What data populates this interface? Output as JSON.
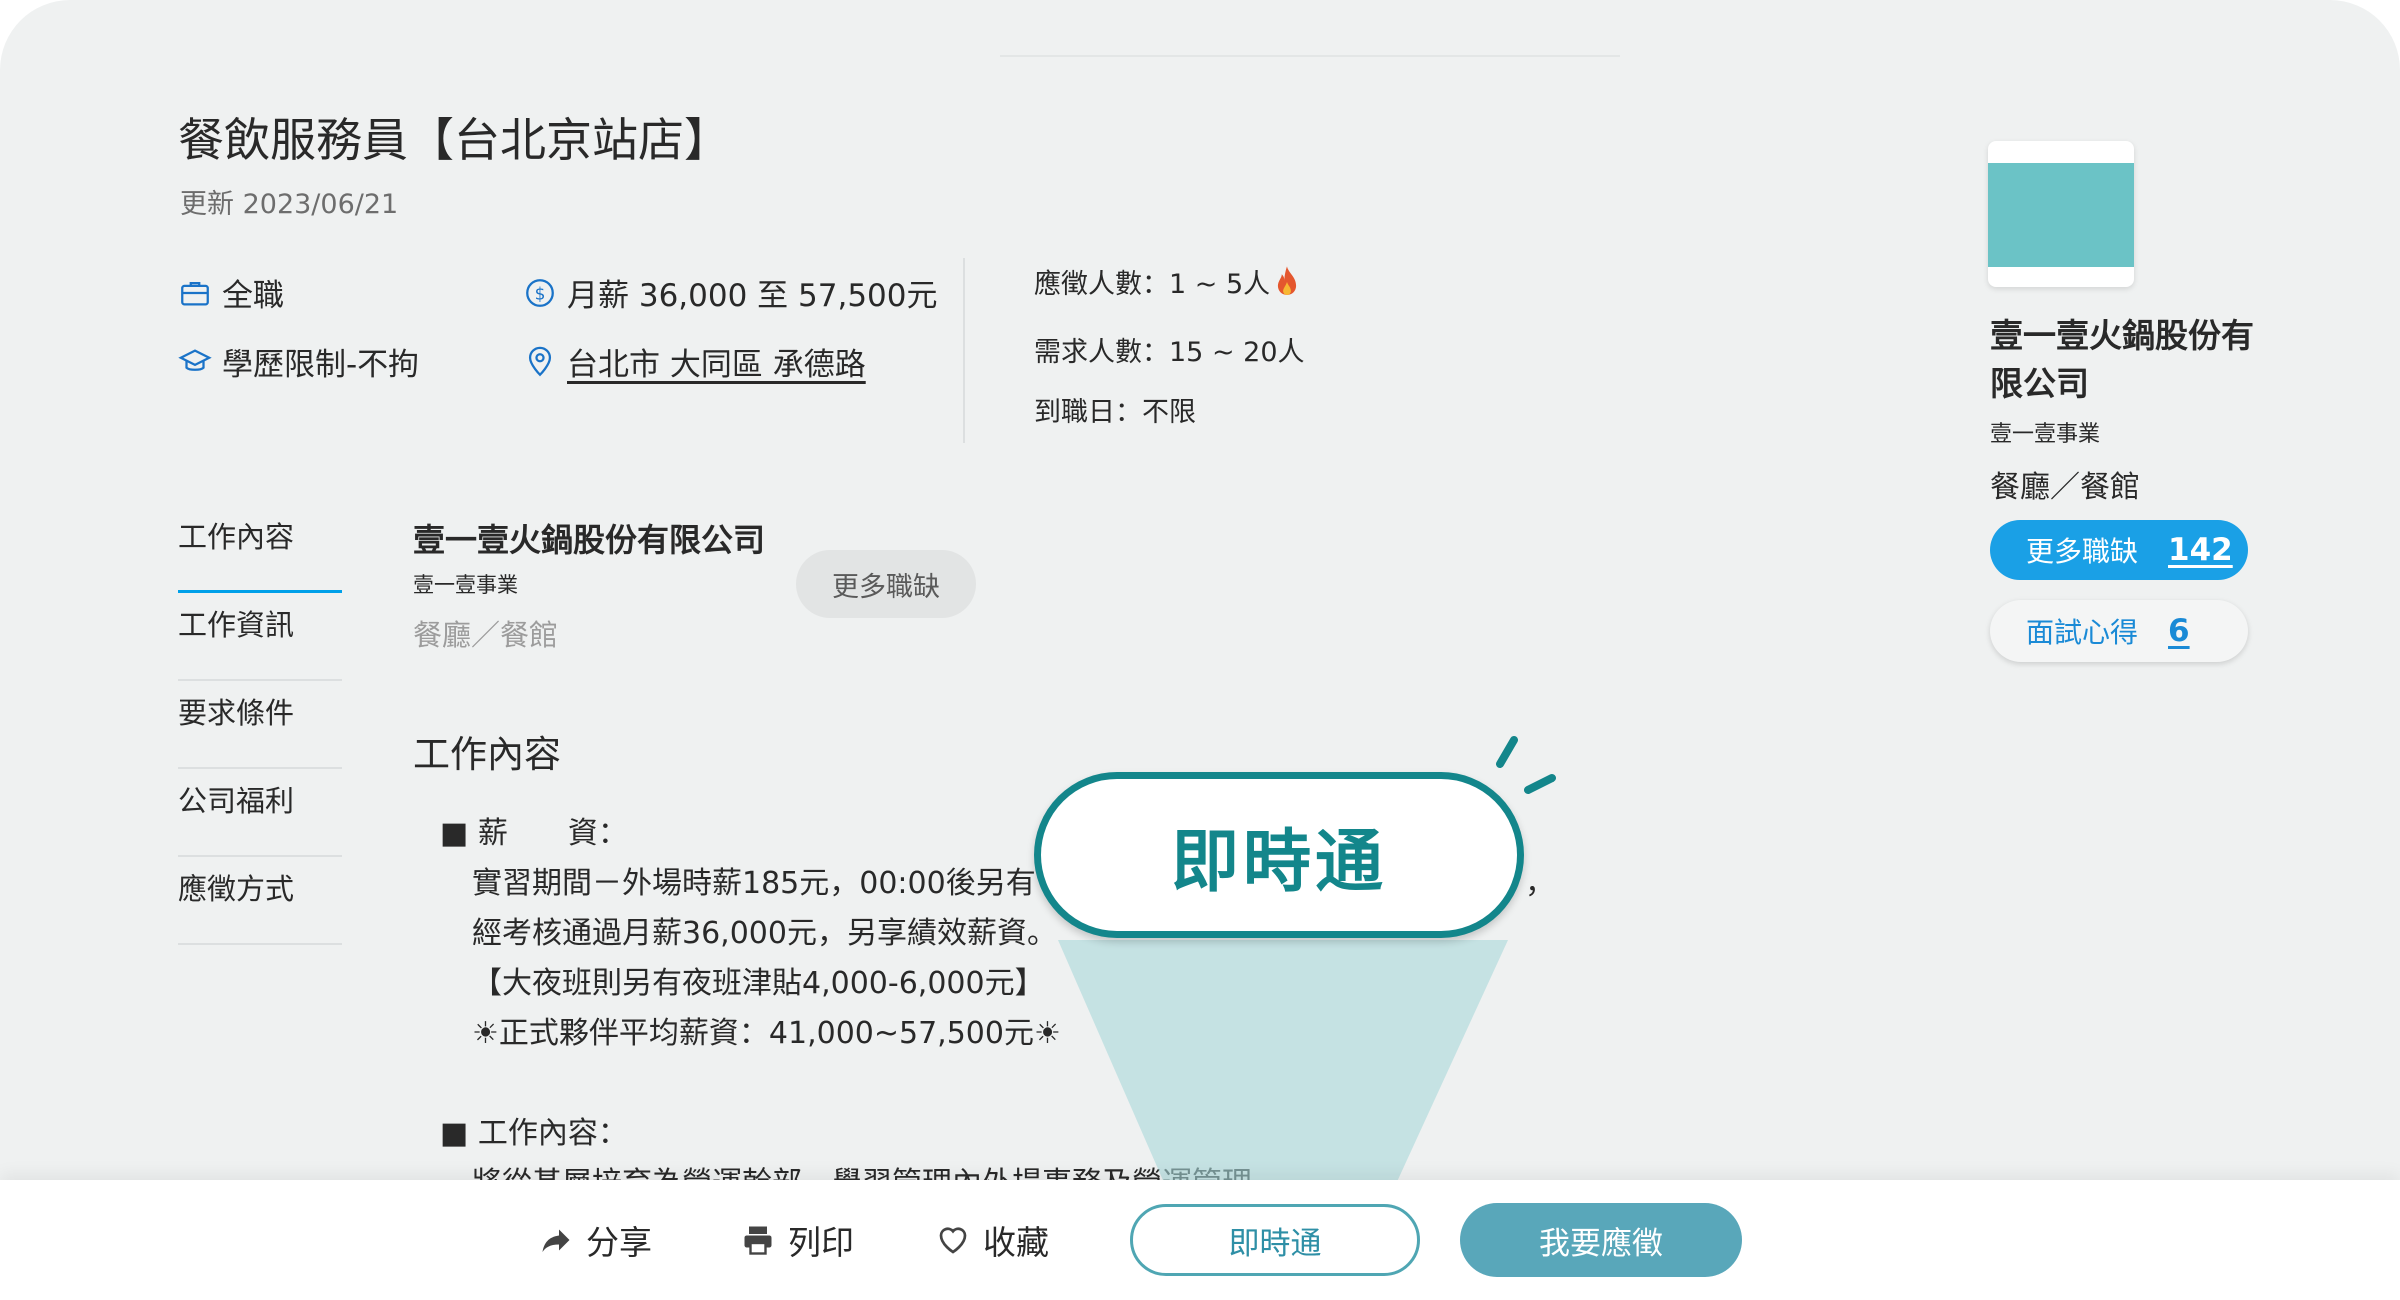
{
  "job": {
    "title": "餐飲服務員【台北京站店】",
    "updated": "更新 2023/06/21",
    "type": "全職",
    "salary": "月薪 36,000 至 57,500元",
    "education": "學歷限制-不拘",
    "location": "台北市 大同區 承德路",
    "applicants": "應徵人數：1 ~ 5人",
    "headcount": "需求人數：15 ~ 20人",
    "start_date": "到職日：不限"
  },
  "side_nav": {
    "items": [
      {
        "label": "工作內容"
      },
      {
        "label": "工作資訊"
      },
      {
        "label": "要求條件"
      },
      {
        "label": "公司福利"
      },
      {
        "label": "應徵方式"
      }
    ]
  },
  "company_block": {
    "name": "壹一壹火鍋股份有限公司",
    "sub": "壹一壹事業",
    "industry": "餐廳／餐館",
    "more_jobs_label": "更多職缺"
  },
  "content": {
    "heading": "工作內容",
    "lines": [
      "■ 薪　　資：",
      "實習期間－外場時薪185元，00:00後另有",
      "，",
      "經考核通過月薪36,000元，另享績效薪資。",
      "【大夜班則另有夜班津貼4,000-6,000元】",
      "☀正式夥伴平均薪資：41,000~57,500元☀",
      "■ 工作內容：",
      "將從基層培育為營運幹部，學習管理內外場事務及營運管理。"
    ]
  },
  "right_panel": {
    "company_name": "壹一壹火鍋股份有限公司",
    "sub": "壹一壹事業",
    "industry": "餐廳／餐館",
    "more_jobs_label": "更多職缺",
    "more_jobs_count": "142",
    "interview_label": "面試心得",
    "interview_count": "6"
  },
  "callout": {
    "label": "即時通"
  },
  "action_bar": {
    "share": "分享",
    "print": "列印",
    "save": "收藏",
    "instant": "即時通",
    "apply": "我要應徵"
  },
  "colors": {
    "accent_blue": "#1aa0e6",
    "teal": "#13868b",
    "apply_button": "#59a7ba",
    "logo": "#6bc3c6"
  },
  "icons": [
    "briefcase-icon",
    "dollar-icon",
    "graduation-cap-icon",
    "map-pin-icon",
    "fire-icon",
    "share-icon",
    "printer-icon",
    "heart-icon"
  ]
}
